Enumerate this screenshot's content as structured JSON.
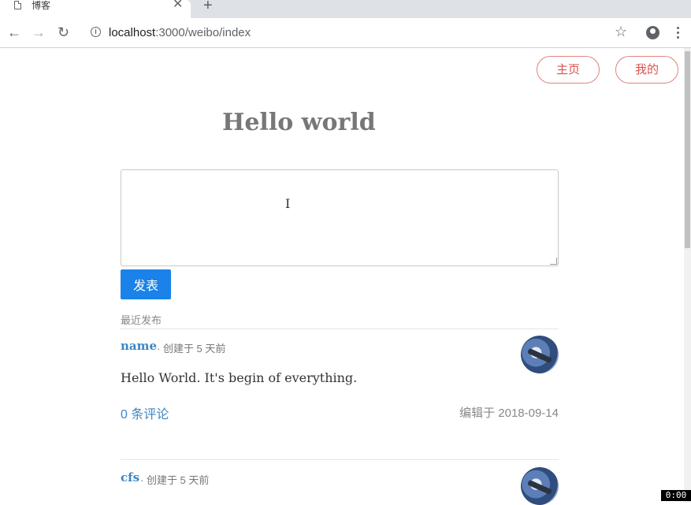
{
  "browser": {
    "tab_title": "博客",
    "url_host": "localhost",
    "url_rest": ":3000/weibo/index"
  },
  "nav": {
    "home_label": "主页",
    "mine_label": "我的"
  },
  "page": {
    "heading": "Hello world",
    "compose_value": "",
    "publish_label": "发表",
    "section_label": "最近发布"
  },
  "posts": [
    {
      "author": "name",
      "created": "· 创建于 5 天前",
      "body": "Hello World. It's begin of everything.",
      "comments": "0 条评论",
      "edited": "编辑于 2018-09-14"
    },
    {
      "author": "cfs",
      "created": "· 创建于 5 天前"
    }
  ],
  "overlay": {
    "timer": "0:00"
  },
  "colors": {
    "accent_blue": "#1a82e8",
    "link_blue": "#3a87c8",
    "pill_red": "#d9534f"
  },
  "icons": [
    "document-icon",
    "close-icon",
    "plus-icon",
    "back-icon",
    "forward-icon",
    "reload-icon",
    "info-icon",
    "star-icon",
    "account-icon",
    "menu-icon",
    "text-cursor-icon"
  ]
}
